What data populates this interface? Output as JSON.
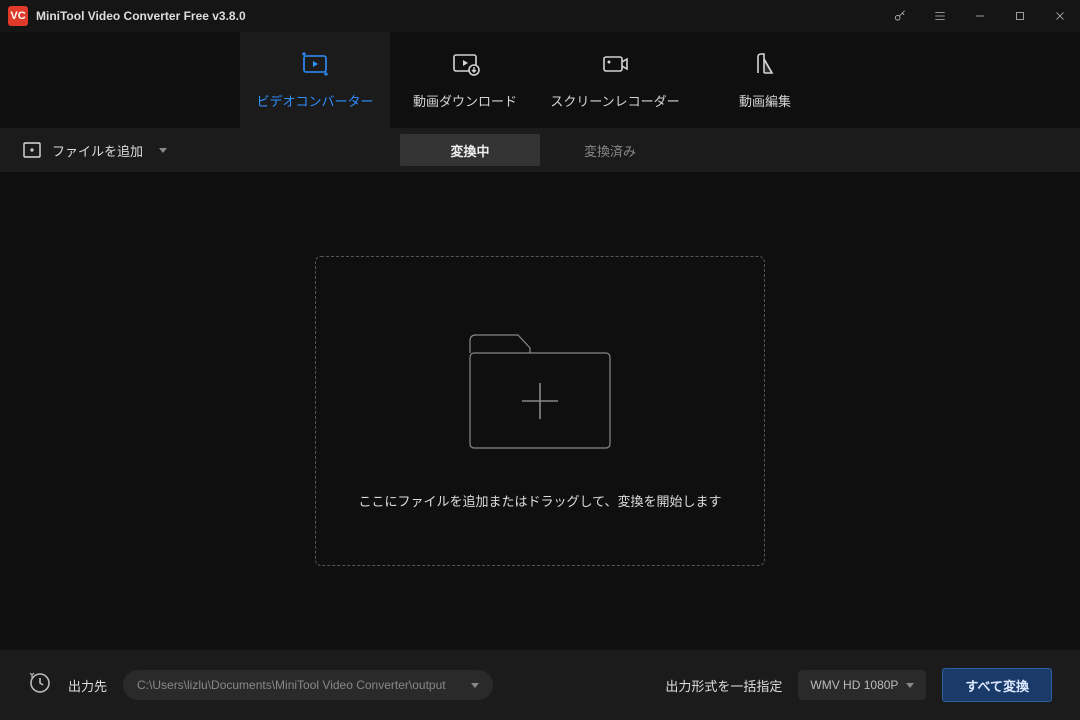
{
  "title": "MiniTool Video Converter Free v3.8.0",
  "tabs": {
    "converter": "ビデオコンバーター",
    "download": "動画ダウンロード",
    "recorder": "スクリーンレコーダー",
    "editor": "動画編集"
  },
  "toolbar": {
    "add_file": "ファイルを追加"
  },
  "status_tabs": {
    "converting": "変換中",
    "converted": "変換済み"
  },
  "dropzone": {
    "text": "ここにファイルを追加またはドラッグして、変換を開始します"
  },
  "bottom": {
    "output_dir_label": "出力先",
    "output_dir_path": "C:\\Users\\lizlu\\Documents\\MiniTool Video Converter\\output",
    "format_label": "出力形式を一括指定",
    "format_value": "WMV HD 1080P",
    "convert_all": "すべて変換"
  }
}
